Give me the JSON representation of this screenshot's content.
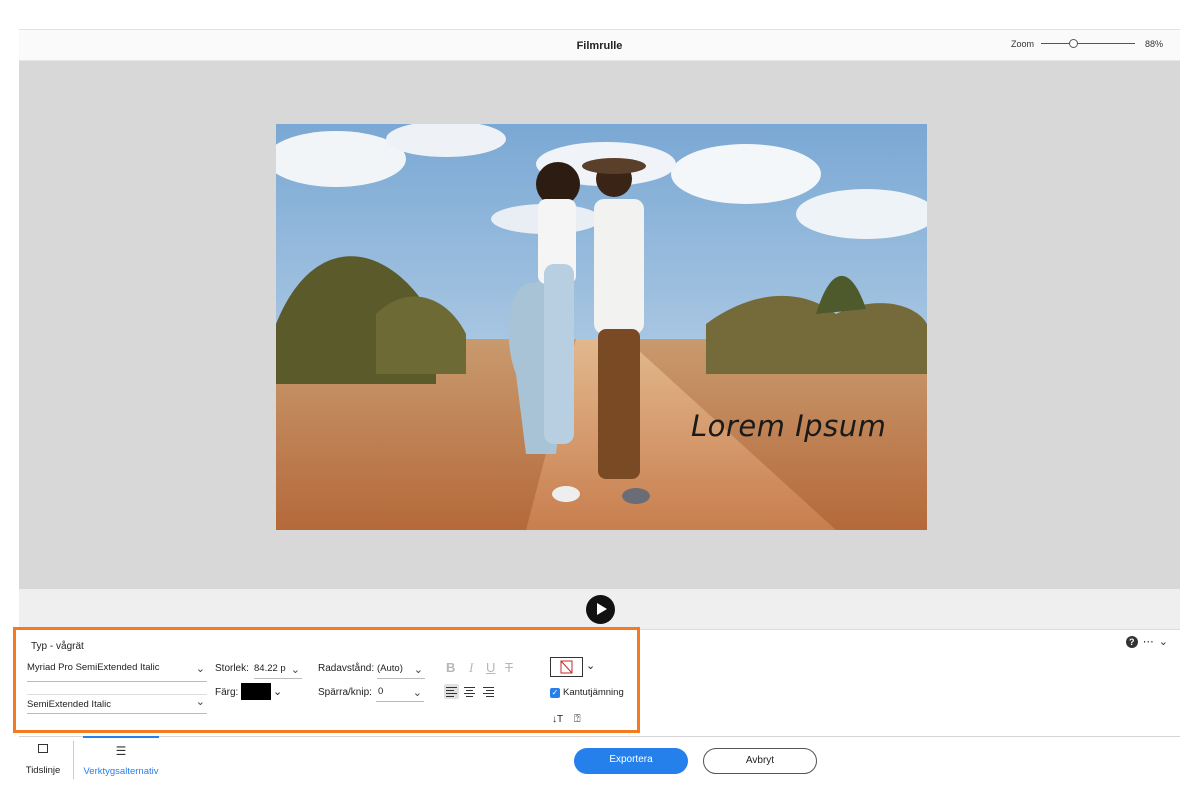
{
  "title": "Filmrulle",
  "zoom": {
    "label": "Zoom",
    "value_label": "88%",
    "value": 0.34
  },
  "canvas": {
    "overlay_text": "Lorem Ipsum"
  },
  "panel": {
    "heading": "Typ - vågrät",
    "font_family": "Myriad Pro SemiExtended Italic",
    "font_style": "SemiExtended Italic",
    "size_label": "Storlek:",
    "size_value": "84.22 p",
    "color_label": "Färg:",
    "color_value": "#000000",
    "leading_label": "Radavstånd:",
    "leading_value": "(Auto)",
    "tracking_label": "Spärra/knip:",
    "tracking_value": "0",
    "bold": "B",
    "italic": "I",
    "underline": "U",
    "strike": "T",
    "antialias_label": "Kantutjämning",
    "antialias_checked": true
  },
  "footer": {
    "timeline_label": "Tidslinje",
    "tool_options_label": "Verktygsalternativ",
    "export_label": "Exportera",
    "cancel_label": "Avbryt"
  },
  "colors": {
    "accent": "#2680eb",
    "highlight": "#f47b20",
    "canvas_bg": "#d8d8d8"
  }
}
